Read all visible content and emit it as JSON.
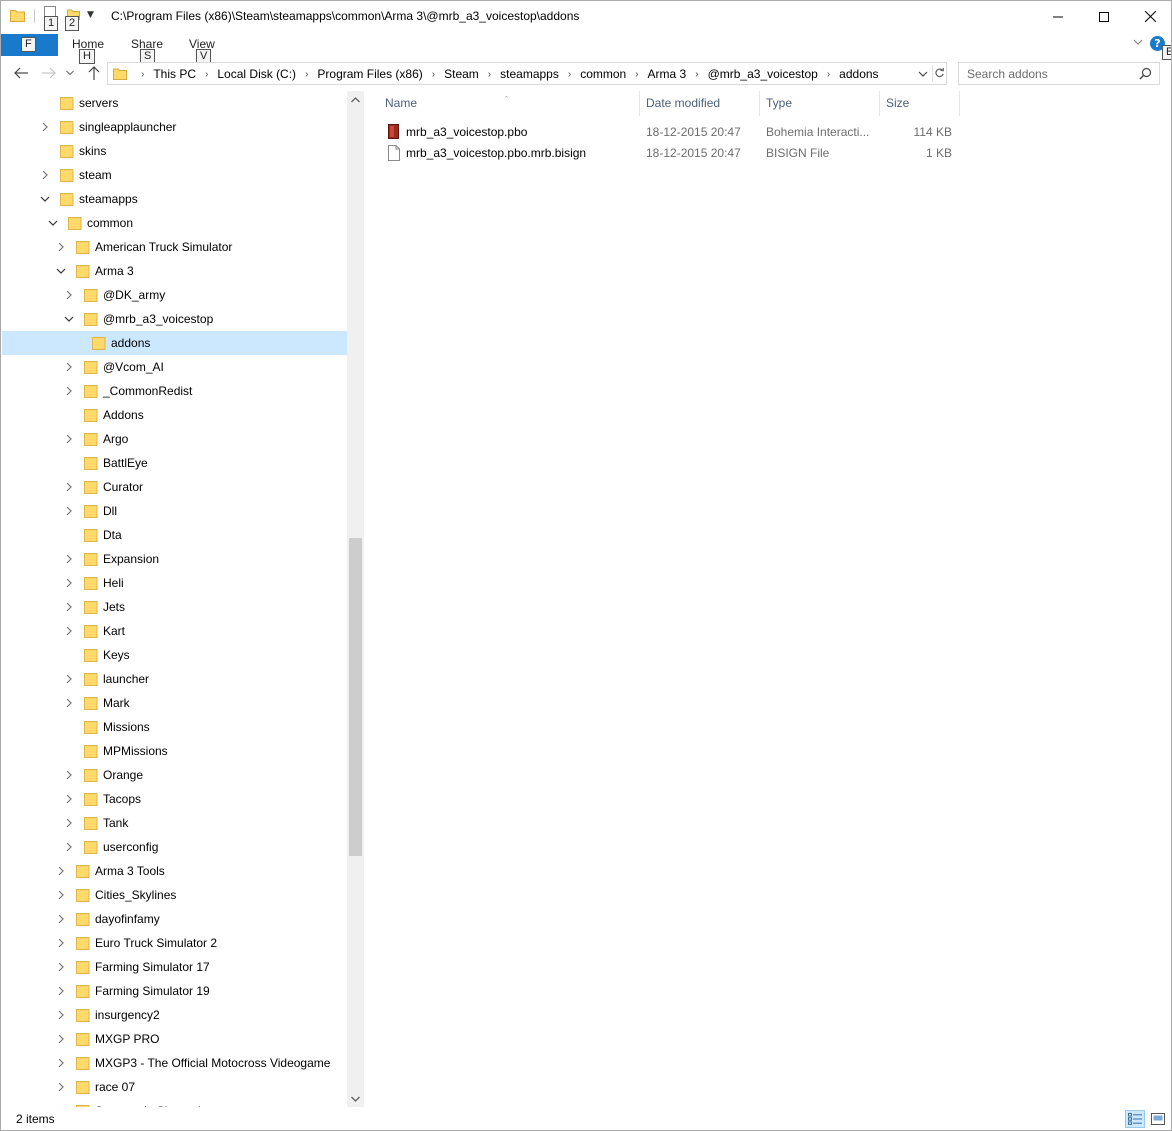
{
  "window": {
    "title": "C:\\Program Files (x86)\\Steam\\steamapps\\common\\Arma 3\\@mrb_a3_voicestop\\addons"
  },
  "keytips": {
    "qa1": "1",
    "qa2": "2",
    "file": "F",
    "home": "H",
    "share": "S",
    "view": "V",
    "help": "E"
  },
  "ribbon": {
    "tabs": [
      "Home",
      "Share",
      "View"
    ]
  },
  "address": {
    "crumbs": [
      "This PC",
      "Local Disk (C:)",
      "Program Files (x86)",
      "Steam",
      "steamapps",
      "common",
      "Arma 3",
      "@mrb_a3_voicestop",
      "addons"
    ]
  },
  "search": {
    "placeholder": "Search addons"
  },
  "tree": [
    {
      "label": "servers",
      "level": 0,
      "chevron": "none"
    },
    {
      "label": "singleapplauncher",
      "level": 0,
      "chevron": "right"
    },
    {
      "label": "skins",
      "level": 0,
      "chevron": "none"
    },
    {
      "label": "steam",
      "level": 0,
      "chevron": "right"
    },
    {
      "label": "steamapps",
      "level": 0,
      "chevron": "down"
    },
    {
      "label": "common",
      "level": 1,
      "chevron": "down"
    },
    {
      "label": "American Truck Simulator",
      "level": 2,
      "chevron": "right"
    },
    {
      "label": "Arma 3",
      "level": 2,
      "chevron": "down"
    },
    {
      "label": "@DK_army",
      "level": 3,
      "chevron": "right"
    },
    {
      "label": "@mrb_a3_voicestop",
      "level": 3,
      "chevron": "down"
    },
    {
      "label": "addons",
      "level": 4,
      "chevron": "none",
      "selected": true
    },
    {
      "label": "@Vcom_AI",
      "level": 3,
      "chevron": "right"
    },
    {
      "label": "_CommonRedist",
      "level": 3,
      "chevron": "right"
    },
    {
      "label": "Addons",
      "level": 3,
      "chevron": "none"
    },
    {
      "label": "Argo",
      "level": 3,
      "chevron": "right"
    },
    {
      "label": "BattlEye",
      "level": 3,
      "chevron": "none"
    },
    {
      "label": "Curator",
      "level": 3,
      "chevron": "right"
    },
    {
      "label": "Dll",
      "level": 3,
      "chevron": "right"
    },
    {
      "label": "Dta",
      "level": 3,
      "chevron": "none"
    },
    {
      "label": "Expansion",
      "level": 3,
      "chevron": "right"
    },
    {
      "label": "Heli",
      "level": 3,
      "chevron": "right"
    },
    {
      "label": "Jets",
      "level": 3,
      "chevron": "right"
    },
    {
      "label": "Kart",
      "level": 3,
      "chevron": "right"
    },
    {
      "label": "Keys",
      "level": 3,
      "chevron": "none"
    },
    {
      "label": "launcher",
      "level": 3,
      "chevron": "right"
    },
    {
      "label": "Mark",
      "level": 3,
      "chevron": "right"
    },
    {
      "label": "Missions",
      "level": 3,
      "chevron": "none"
    },
    {
      "label": "MPMissions",
      "level": 3,
      "chevron": "none"
    },
    {
      "label": "Orange",
      "level": 3,
      "chevron": "right"
    },
    {
      "label": "Tacops",
      "level": 3,
      "chevron": "right"
    },
    {
      "label": "Tank",
      "level": 3,
      "chevron": "right"
    },
    {
      "label": "userconfig",
      "level": 3,
      "chevron": "right"
    },
    {
      "label": "Arma 3 Tools",
      "level": 2,
      "chevron": "right"
    },
    {
      "label": "Cities_Skylines",
      "level": 2,
      "chevron": "right"
    },
    {
      "label": "dayofinfamy",
      "level": 2,
      "chevron": "right"
    },
    {
      "label": "Euro Truck Simulator 2",
      "level": 2,
      "chevron": "right"
    },
    {
      "label": "Farming Simulator 17",
      "level": 2,
      "chevron": "right"
    },
    {
      "label": "Farming Simulator 19",
      "level": 2,
      "chevron": "right"
    },
    {
      "label": "insurgency2",
      "level": 2,
      "chevron": "right"
    },
    {
      "label": "MXGP PRO",
      "level": 2,
      "chevron": "right"
    },
    {
      "label": "MXGP3 - The Official Motocross Videogame",
      "level": 2,
      "chevron": "right"
    },
    {
      "label": "race 07",
      "level": 2,
      "chevron": "right"
    },
    {
      "label": "Streamer's Channel",
      "level": 2,
      "chevron": "right"
    }
  ],
  "columns": {
    "name": "Name",
    "date": "Date modified",
    "type": "Type",
    "size": "Size"
  },
  "files": [
    {
      "name": "mrb_a3_voicestop.pbo",
      "date": "18-12-2015 20:47",
      "type": "Bohemia Interacti...",
      "size": "114 KB",
      "icon": "pbo-file-icon"
    },
    {
      "name": "mrb_a3_voicestop.pbo.mrb.bisign",
      "date": "18-12-2015 20:47",
      "type": "BISIGN File",
      "size": "1 KB",
      "icon": "generic-file-icon"
    }
  ],
  "status": {
    "items": "2 items"
  },
  "colors": {
    "accent": "#1979ca",
    "selection": "#cce8ff",
    "folder": "#ffd969"
  }
}
